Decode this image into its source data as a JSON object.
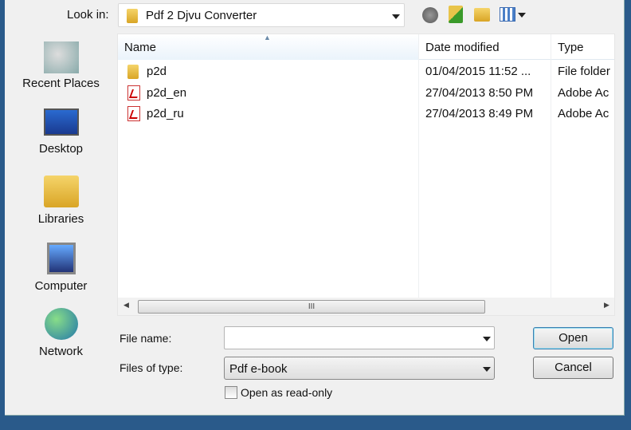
{
  "look_in": {
    "label": "Look in:",
    "value": "Pdf 2 Djvu Converter"
  },
  "toolbar": {
    "icons": [
      "back-icon",
      "up-folder-icon",
      "new-folder-icon",
      "view-menu-icon"
    ]
  },
  "places": [
    {
      "label": "Recent Places",
      "icon": "recent-places-icon"
    },
    {
      "label": "Desktop",
      "icon": "desktop-icon"
    },
    {
      "label": "Libraries",
      "icon": "libraries-icon"
    },
    {
      "label": "Computer",
      "icon": "computer-icon"
    },
    {
      "label": "Network",
      "icon": "network-icon"
    }
  ],
  "columns": [
    "Name",
    "Date modified",
    "Type"
  ],
  "files": [
    {
      "name": "p2d",
      "date": "01/04/2015 11:52 ...",
      "type": "File folder",
      "icon": "folder-icon"
    },
    {
      "name": "p2d_en",
      "date": "27/04/2013 8:50 PM",
      "type": "Adobe Ac",
      "icon": "pdf-icon"
    },
    {
      "name": "p2d_ru",
      "date": "27/04/2013 8:49 PM",
      "type": "Adobe Ac",
      "icon": "pdf-icon"
    }
  ],
  "scroll_grip": "III",
  "file_name": {
    "label": "File name:",
    "value": ""
  },
  "file_type": {
    "label": "Files of type:",
    "value": "Pdf e-book"
  },
  "read_only": {
    "label": "Open as read-only",
    "checked": false
  },
  "buttons": {
    "open": "Open",
    "cancel": "Cancel"
  }
}
